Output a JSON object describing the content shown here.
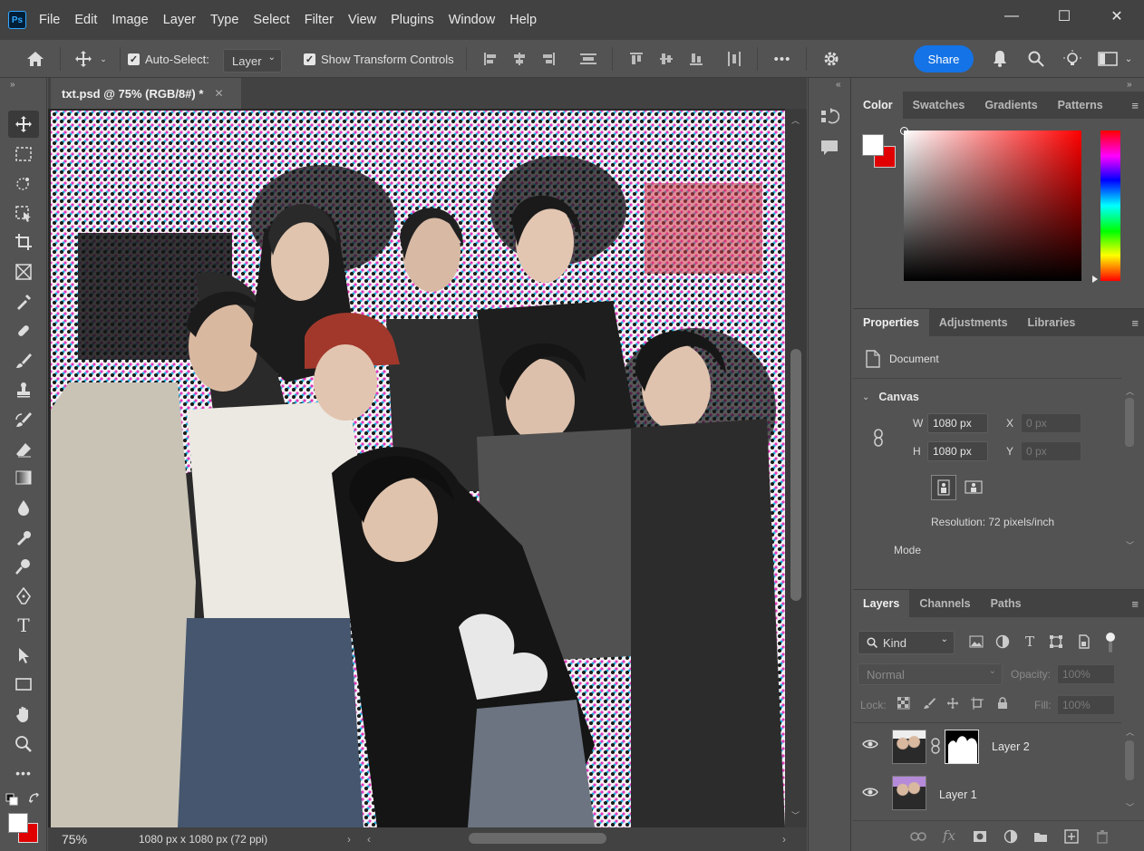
{
  "app": {
    "logo": "Ps"
  },
  "menu": [
    "File",
    "Edit",
    "Image",
    "Layer",
    "Type",
    "Select",
    "Filter",
    "View",
    "Plugins",
    "Window",
    "Help"
  ],
  "window_controls": {
    "minimize": "—",
    "maximize": "☐",
    "close": "✕"
  },
  "options_bar": {
    "auto_select_label": "Auto-Select:",
    "auto_select_checked": true,
    "auto_select_target": "Layer",
    "show_transform_label": "Show Transform Controls",
    "show_transform_checked": true,
    "more": "•••",
    "share_label": "Share"
  },
  "document": {
    "tab_title": "txt.psd @ 75% (RGB/8#) *",
    "zoom": "75%",
    "status": "1080 px x 1080 px (72 ppi)"
  },
  "color_panel": {
    "tabs": [
      "Color",
      "Swatches",
      "Gradients",
      "Patterns"
    ],
    "active_tab": "Color",
    "foreground": "#ffffff",
    "background": "#e00000",
    "hue_color": "#ff0000"
  },
  "properties_panel": {
    "tabs": [
      "Properties",
      "Adjustments",
      "Libraries"
    ],
    "active_tab": "Properties",
    "section_label": "Document",
    "canvas_label": "Canvas",
    "w_label": "W",
    "w_value": "1080 px",
    "h_label": "H",
    "h_value": "1080 px",
    "x_label": "X",
    "x_value": "0 px",
    "y_label": "Y",
    "y_value": "0 px",
    "resolution": "Resolution: 72 pixels/inch",
    "mode_label": "Mode"
  },
  "layers_panel": {
    "tabs": [
      "Layers",
      "Channels",
      "Paths"
    ],
    "active_tab": "Layers",
    "filter_kind": "Kind",
    "blend_mode": "Normal",
    "opacity_label": "Opacity:",
    "opacity_value": "100%",
    "lock_label": "Lock:",
    "fill_label": "Fill:",
    "fill_value": "100%",
    "layers": [
      {
        "name": "Layer 2",
        "visible": true,
        "has_mask": true
      },
      {
        "name": "Layer 1",
        "visible": true,
        "has_mask": false
      }
    ]
  }
}
